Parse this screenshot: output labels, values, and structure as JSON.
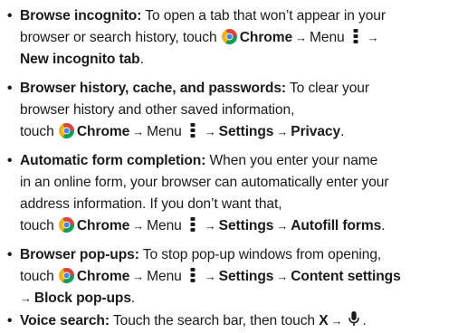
{
  "arrow": "→",
  "bullet": "•",
  "items": [
    {
      "title": "Browse incognito:",
      "l1_text": " To open a tab that won’t appear in your",
      "l2_text": "browser or search history, touch",
      "chrome": "Chrome",
      "menu": "Menu",
      "l3_bold": "New incognito tab",
      "l3_end": "."
    },
    {
      "title": "Browser history, cache, and passwords:",
      "l1_text": " To clear your",
      "l2_text": "browser history and other saved information,",
      "l3_text": "touch",
      "chrome": "Chrome",
      "menu": "Menu",
      "settings": "Settings",
      "privacy": "Privacy",
      "end": "."
    },
    {
      "title": "Automatic form completion:",
      "l1_text": " When you enter your name",
      "l2_text": "in an online form, your browser can automatically enter your",
      "l3_text": "address information. If you don’t want that,",
      "l4_text": "touch",
      "chrome": "Chrome",
      "menu": "Menu",
      "settings": "Settings",
      "autofill": "Autofill forms",
      "end": "."
    },
    {
      "title": "Browser pop-ups:",
      "l1_text": " To stop pop-up windows from opening,",
      "l2_text": "touch",
      "chrome": "Chrome",
      "menu": "Menu",
      "settings": "Settings",
      "content": "Content settings",
      "block": "Block pop-ups",
      "end": "."
    },
    {
      "title": "Voice search:",
      "l1_text": " Touch the search bar, then touch",
      "x": "X",
      "end": "."
    }
  ],
  "colors": {
    "text": "#1a1a1a",
    "chrome_red": "#db4437",
    "chrome_yellow": "#f4b400",
    "chrome_green": "#0f9d58",
    "chrome_blue": "#4285f4"
  }
}
